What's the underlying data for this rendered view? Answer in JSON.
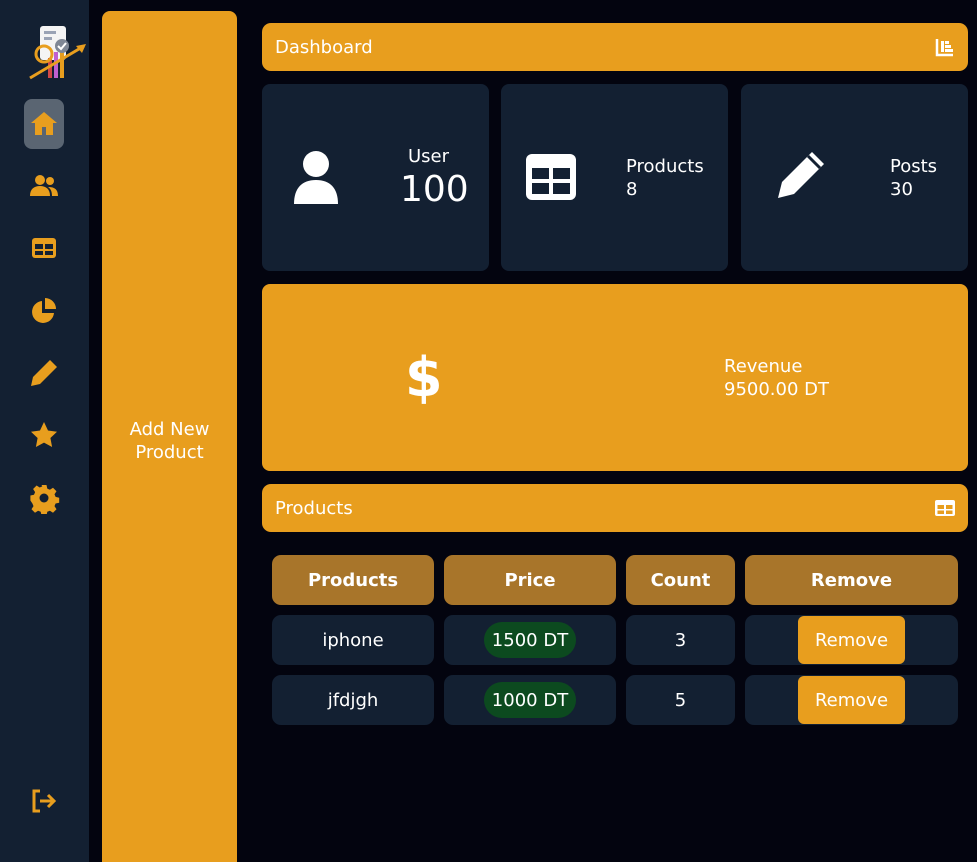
{
  "colors": {
    "accent": "#e89e1e",
    "panel": "#132032",
    "background": "#03040f",
    "price_pill": "#0c4a1f",
    "header_cell": "#a8752a"
  },
  "sidebar": {
    "items": [
      {
        "icon": "home-icon",
        "active": true
      },
      {
        "icon": "users-icon",
        "active": false
      },
      {
        "icon": "table-icon",
        "active": false
      },
      {
        "icon": "pie-chart-icon",
        "active": false
      },
      {
        "icon": "pencil-icon",
        "active": false
      },
      {
        "icon": "star-icon",
        "active": false
      },
      {
        "icon": "gear-icon",
        "active": false
      }
    ],
    "logout_icon": "logout-icon"
  },
  "add_panel": {
    "label": "Add New Product"
  },
  "dashboard": {
    "title": "Dashboard",
    "icon": "bar-chart-icon"
  },
  "stats": {
    "user": {
      "label": "User",
      "value": "100",
      "icon": "user-icon"
    },
    "products": {
      "label": "Products",
      "value": "8",
      "icon": "table-icon"
    },
    "posts": {
      "label": "Posts",
      "value": "30",
      "icon": "pencil-icon"
    }
  },
  "revenue": {
    "label": "Revenue",
    "value": "9500.00 DT",
    "icon": "dollar-icon"
  },
  "products_section": {
    "title": "Products",
    "icon": "table-icon"
  },
  "table": {
    "headers": [
      "Products",
      "Price",
      "Count",
      "Remove"
    ],
    "rows": [
      {
        "product": "iphone",
        "price": "1500 DT",
        "count": "3",
        "action": "Remove"
      },
      {
        "product": "jfdjgh",
        "price": "1000 DT",
        "count": "5",
        "action": "Remove"
      }
    ]
  }
}
